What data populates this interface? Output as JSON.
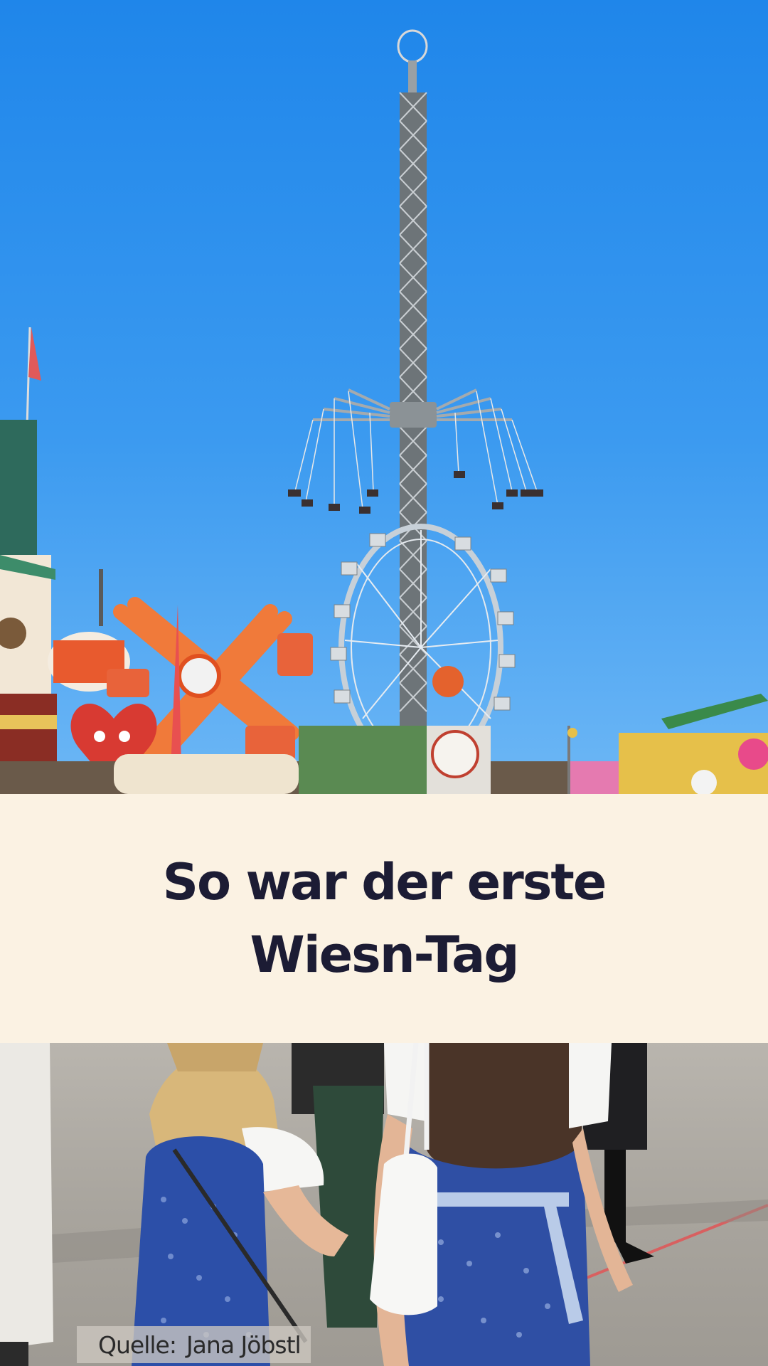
{
  "headline": {
    "line1": "So war der erste",
    "line2": "Wiesn-Tag"
  },
  "source": {
    "label": "Quelle:",
    "author": "Jana Jöbstl"
  },
  "colors": {
    "sky": "#2a8fee",
    "title_band": "#fbf2e3",
    "title_text": "#1c1c34",
    "dirndl_blue": "#2c4fa8"
  },
  "photo": {
    "top_scene": "Oktoberfest fairground with a tall chain-swing tower, Ferris wheel and fairground rides under a blue sky",
    "bottom_scene": "Visitors in blue dirndls walking across the fairground"
  }
}
